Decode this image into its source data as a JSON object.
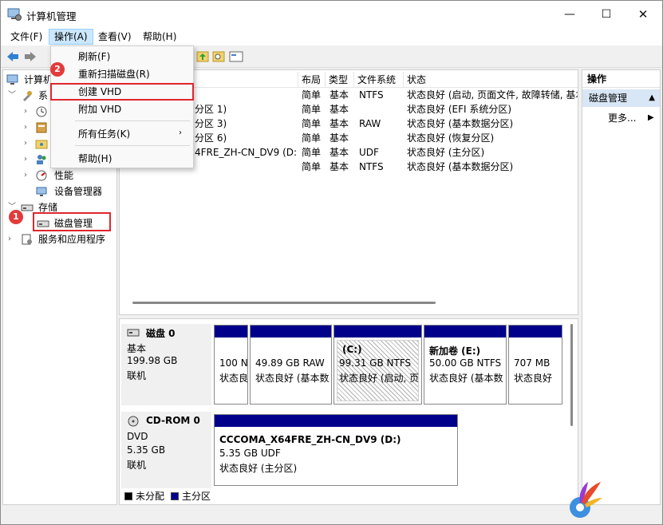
{
  "window": {
    "title": "计算机管理",
    "minimize_icon": "—",
    "maximize_icon": "☐",
    "close_icon": "✕"
  },
  "menubar": {
    "file": "文件(F)",
    "action": "操作(A)",
    "view": "查看(V)",
    "help": "帮助(H)"
  },
  "context_menu": {
    "items": [
      "刷新(F)",
      "重新扫描磁盘(R)",
      "创建 VHD",
      "附加 VHD",
      "所有任务(K)",
      "帮助(H)"
    ],
    "submenu_arrow": "›"
  },
  "tree": {
    "root": "计算机",
    "system": "系",
    "performance": "性能",
    "device_manager": "设备管理器",
    "storage": "存储",
    "disk_management": "磁盘管理",
    "services": "服务和应用程序"
  },
  "list": {
    "columns": [
      "布局",
      "类型",
      "文件系统",
      "状态"
    ],
    "rows": [
      {
        "name": "",
        "layout": "简单",
        "type": "基本",
        "fs": "NTFS",
        "status": "状态良好 (启动, 页面文件, 故障转储, 基本"
      },
      {
        "name": "分区 1)",
        "layout": "简单",
        "type": "基本",
        "fs": "",
        "status": "状态良好 (EFI 系统分区)"
      },
      {
        "name": "分区 3)",
        "layout": "简单",
        "type": "基本",
        "fs": "RAW",
        "status": "状态良好 (基本数据分区)"
      },
      {
        "name": "分区 6)",
        "layout": "简单",
        "type": "基本",
        "fs": "",
        "status": "状态良好 (恢复分区)"
      },
      {
        "name": "4FRE_ZH-CN_DV9 (D:)",
        "layout": "简单",
        "type": "基本",
        "fs": "UDF",
        "status": "状态良好 (主分区)"
      },
      {
        "name": "",
        "layout": "简单",
        "type": "基本",
        "fs": "NTFS",
        "status": "状态良好 (基本数据分区)"
      }
    ]
  },
  "actions": {
    "header": "操作",
    "section": "磁盘管理",
    "section_arrow": "▲",
    "more": "更多...",
    "more_arrow": "▶"
  },
  "disks": [
    {
      "name": "磁盘 0",
      "type": "基本",
      "size": "199.98 GB",
      "state": "联机",
      "partitions": [
        {
          "title": "",
          "size": "100 N",
          "status": "状态良"
        },
        {
          "title": "",
          "size": "49.89 GB RAW",
          "status": "状态良好 (基本数"
        },
        {
          "title": "(C:)",
          "size": "99.31 GB NTFS",
          "status": "状态良好 (启动, 页"
        },
        {
          "title": "新加卷  (E:)",
          "size": "50.00 GB NTFS",
          "status": "状态良好 (基本数"
        },
        {
          "title": "",
          "size": "707 MB",
          "status": "状态良好"
        }
      ]
    },
    {
      "name": "CD-ROM 0",
      "type": "DVD",
      "size": "5.35 GB",
      "state": "联机",
      "partitions": [
        {
          "title": "CCCOMA_X64FRE_ZH-CN_DV9  (D:)",
          "size": "5.35 GB UDF",
          "status": "状态良好 (主分区)"
        }
      ]
    }
  ],
  "legend": {
    "unallocated": "未分配",
    "primary": "主分区"
  },
  "badges": {
    "one": "1",
    "two": "2"
  },
  "colors": {
    "partition_bar": "#00008b",
    "highlight": "#e0262e",
    "menu_active": "#cce8ff"
  }
}
